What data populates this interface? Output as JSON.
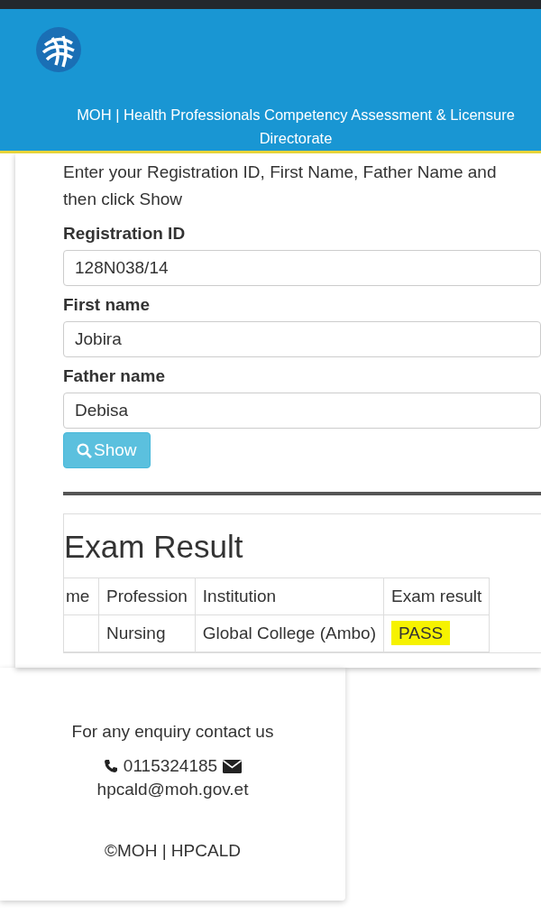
{
  "header": {
    "title": "MOH | Health Professionals Competency Assessment & Licensure Directorate"
  },
  "form": {
    "instructions": "Enter your Registration ID, First Name, Father Name and then click Show",
    "fields": [
      {
        "label": "Registration ID",
        "value": "128N038/14"
      },
      {
        "label": "First name",
        "value": "Jobira"
      },
      {
        "label": "Father name",
        "value": "Debisa"
      }
    ],
    "show_button": "Show"
  },
  "result": {
    "title": "Exam Result",
    "columns": [
      "me",
      "Profession",
      "Institution",
      "Exam result"
    ],
    "rows": [
      {
        "cells": [
          "",
          "Nursing",
          "Global College (Ambo)",
          "PASS"
        ],
        "passed": true
      }
    ]
  },
  "footer": {
    "enquiry": "For any enquiry contact us",
    "phone": "0115324185",
    "email": "hpcald@moh.gov.et",
    "copyright": "©MOH | HPCALD"
  }
}
